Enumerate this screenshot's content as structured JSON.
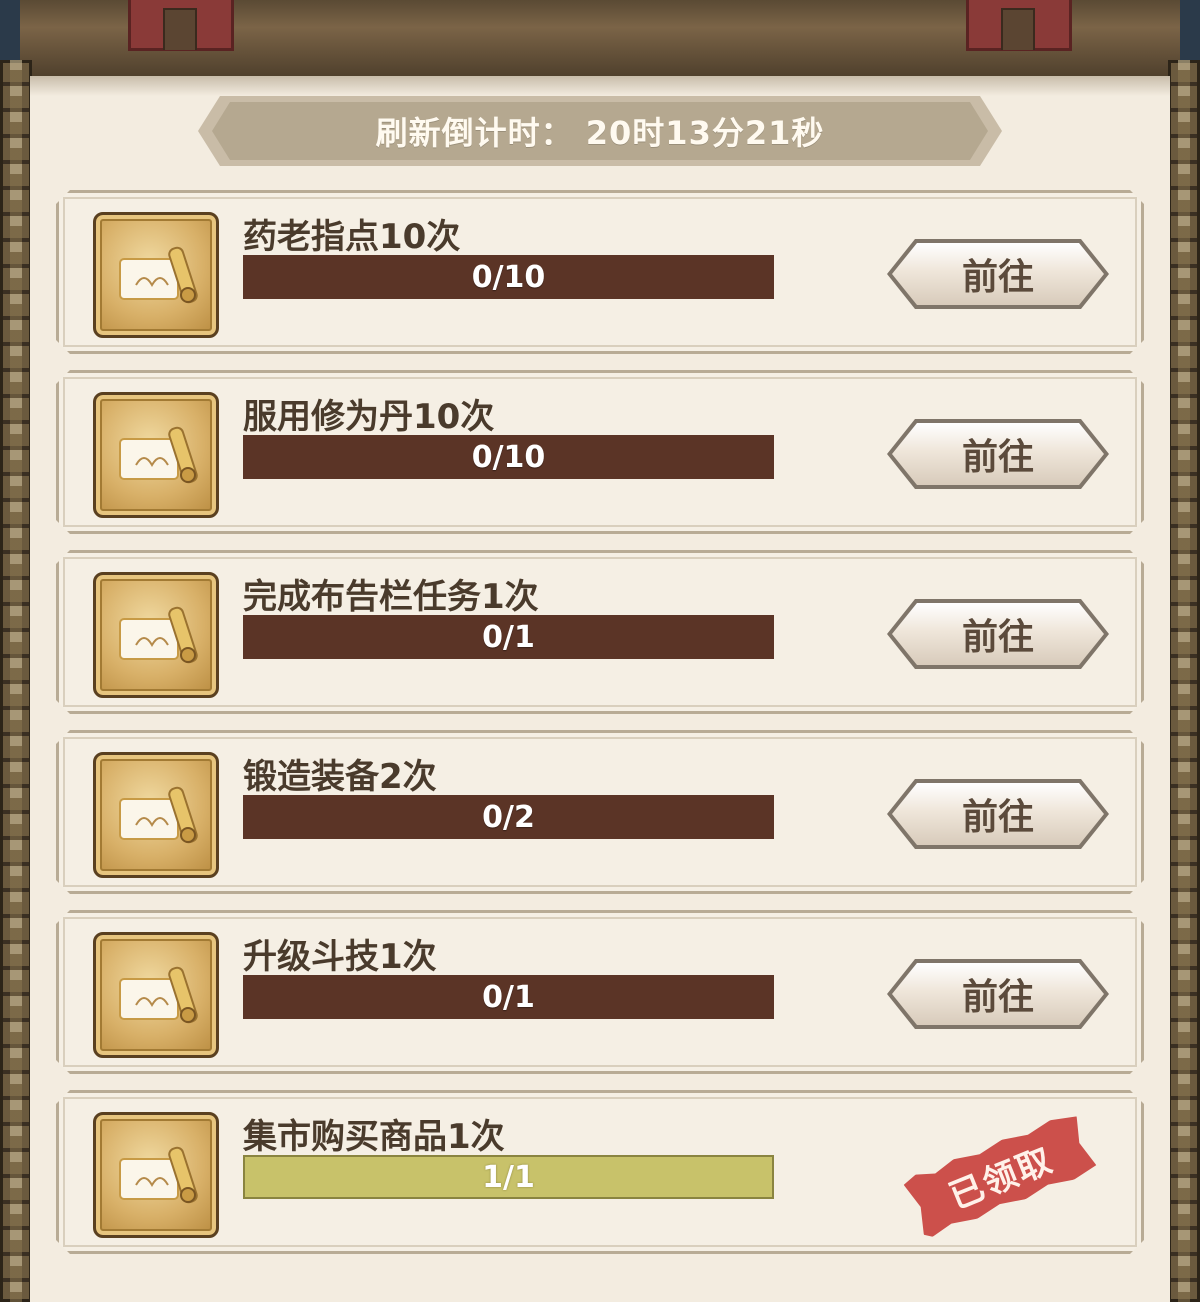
{
  "countdown": "刷新倒计时： 20时13分21秒",
  "tasks": [
    {
      "title": "药老指点10次",
      "progress_text": "0/10",
      "progress": 0.0,
      "action": "前往"
    },
    {
      "title": "服用修为丹10次",
      "progress_text": "0/10",
      "progress": 0.0,
      "action": "前往"
    },
    {
      "title": "完成布告栏任务1次",
      "progress_text": "0/1",
      "progress": 0.0,
      "action": "前往"
    },
    {
      "title": "锻造装备2次",
      "progress_text": "0/2",
      "progress": 0.0,
      "action": "前往"
    },
    {
      "title": "升级斗技1次",
      "progress_text": "0/1",
      "progress": 0.0,
      "action": "前往"
    },
    {
      "title": "集市购买商品1次",
      "progress_text": "1/1",
      "progress": 1.0,
      "status": "已领取"
    }
  ],
  "colors": {
    "progress_empty": "#5b3426",
    "progress_full": "#c8c26a",
    "stamp": "#c8433e",
    "card_border": "#b8ab95"
  },
  "icons": {
    "task_icon": "scroll-icon"
  }
}
